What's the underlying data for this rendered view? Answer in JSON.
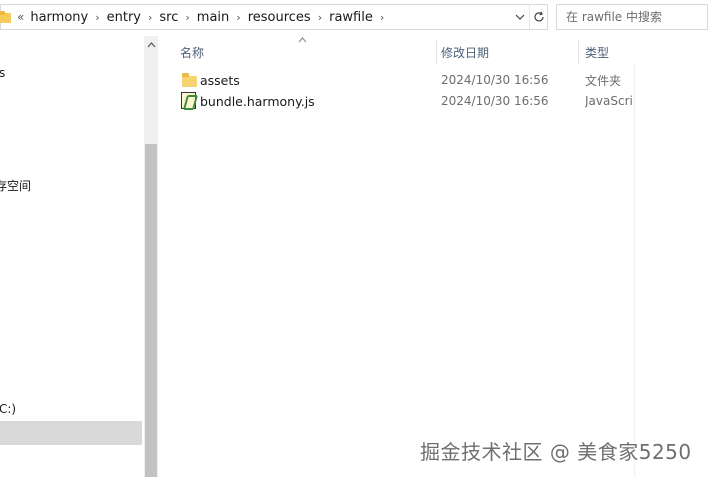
{
  "address_bar": {
    "overflow": "«",
    "crumbs": [
      "harmony",
      "entry",
      "src",
      "main",
      "resources",
      "rawfile"
    ],
    "separator": "›",
    "dropdown_icon": "chevron-down-icon",
    "refresh_icon": "refresh-icon"
  },
  "search": {
    "placeholder": "在 rawfile 中搜索"
  },
  "nav": {
    "items": [
      {
        "label": "s"
      },
      {
        "label": "存空间"
      },
      {
        "label": "C:)"
      }
    ]
  },
  "file_list": {
    "columns": {
      "name": "名称",
      "date": "修改日期",
      "type": "类型"
    },
    "rows": [
      {
        "name": "assets",
        "date": "2024/10/30 16:56",
        "type": "文件夹",
        "icon": "folder-icon"
      },
      {
        "name": "bundle.harmony.js",
        "date": "2024/10/30 16:56",
        "type": "JavaScript",
        "icon": "js-file-icon"
      }
    ]
  },
  "watermark": "掘金技术社区 @ 美食家5250",
  "colors": {
    "header_text": "#4c607a",
    "folder": "#f7d472",
    "selection": "#d9d9d9"
  }
}
